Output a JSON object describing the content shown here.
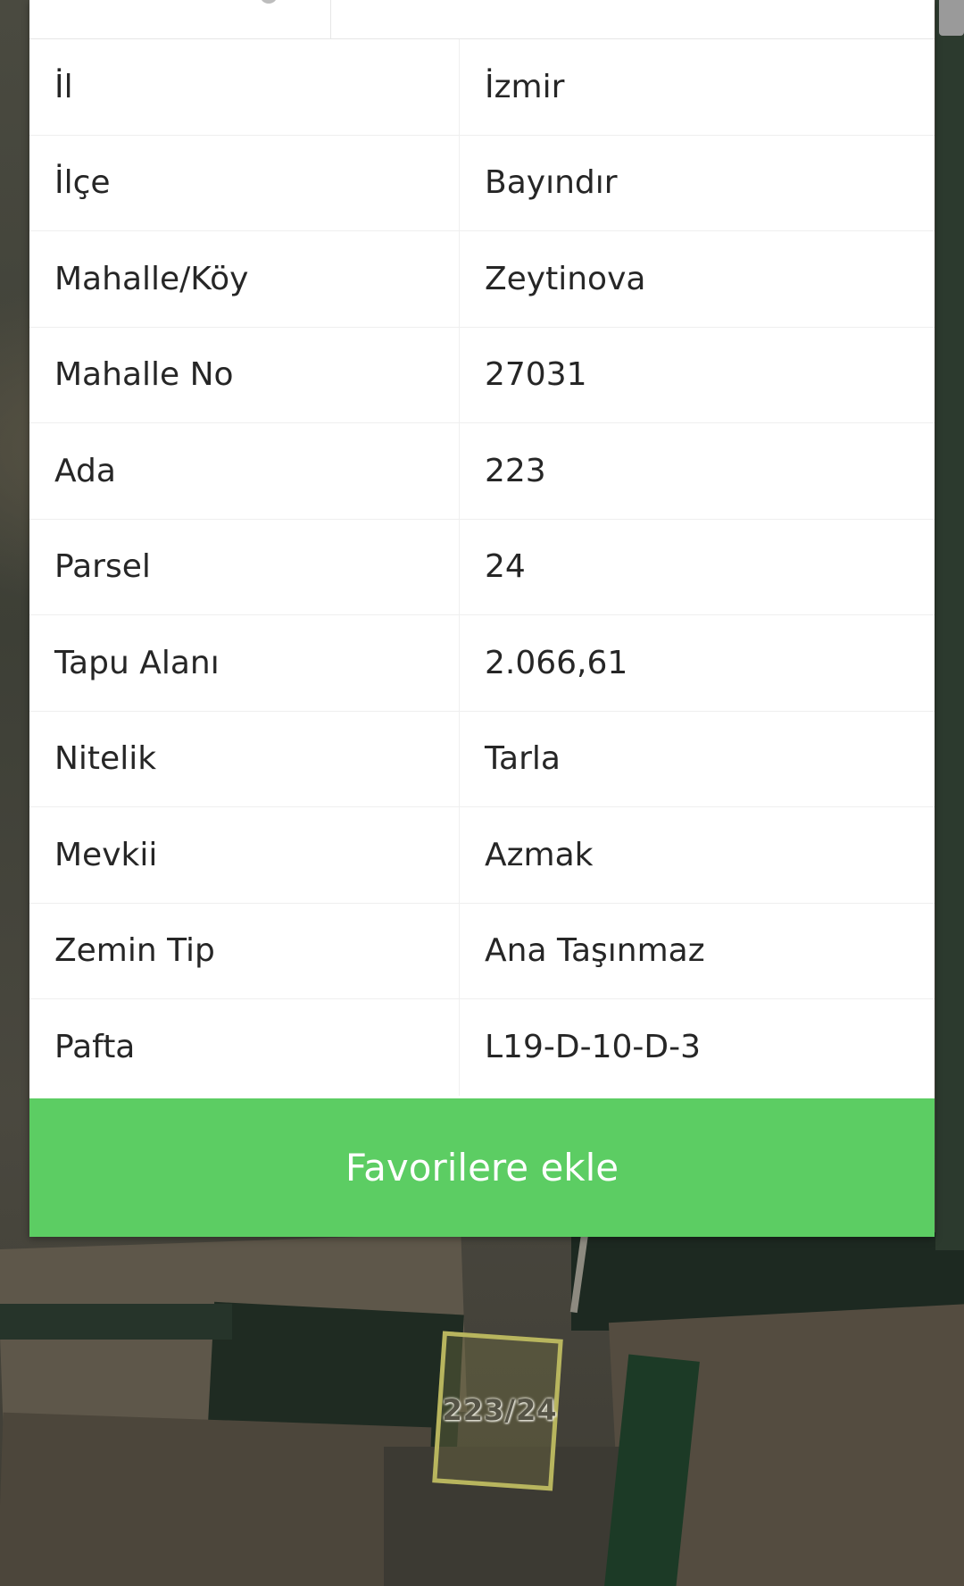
{
  "parcel_info": {
    "rows": [
      {
        "label": "İl",
        "value": "İzmir"
      },
      {
        "label": "İlçe",
        "value": "Bayındır"
      },
      {
        "label": "Mahalle/Köy",
        "value": "Zeytinova"
      },
      {
        "label": "Mahalle No",
        "value": "27031"
      },
      {
        "label": "Ada",
        "value": "223"
      },
      {
        "label": "Parsel",
        "value": "24"
      },
      {
        "label": "Tapu Alanı",
        "value": "2.066,61"
      },
      {
        "label": "Nitelik",
        "value": "Tarla"
      },
      {
        "label": "Mevkii",
        "value": "Azmak"
      },
      {
        "label": "Zemin Tip",
        "value": "Ana Taşınmaz"
      },
      {
        "label": "Pafta",
        "value": "L19-D-10-D-3"
      }
    ]
  },
  "actions": {
    "favorite_label": "Favorilere ekle"
  },
  "map": {
    "parcel_label": "223/24",
    "parcel_outline_color": "#b8b55e"
  },
  "colors": {
    "button_green": "#5ccd63"
  }
}
